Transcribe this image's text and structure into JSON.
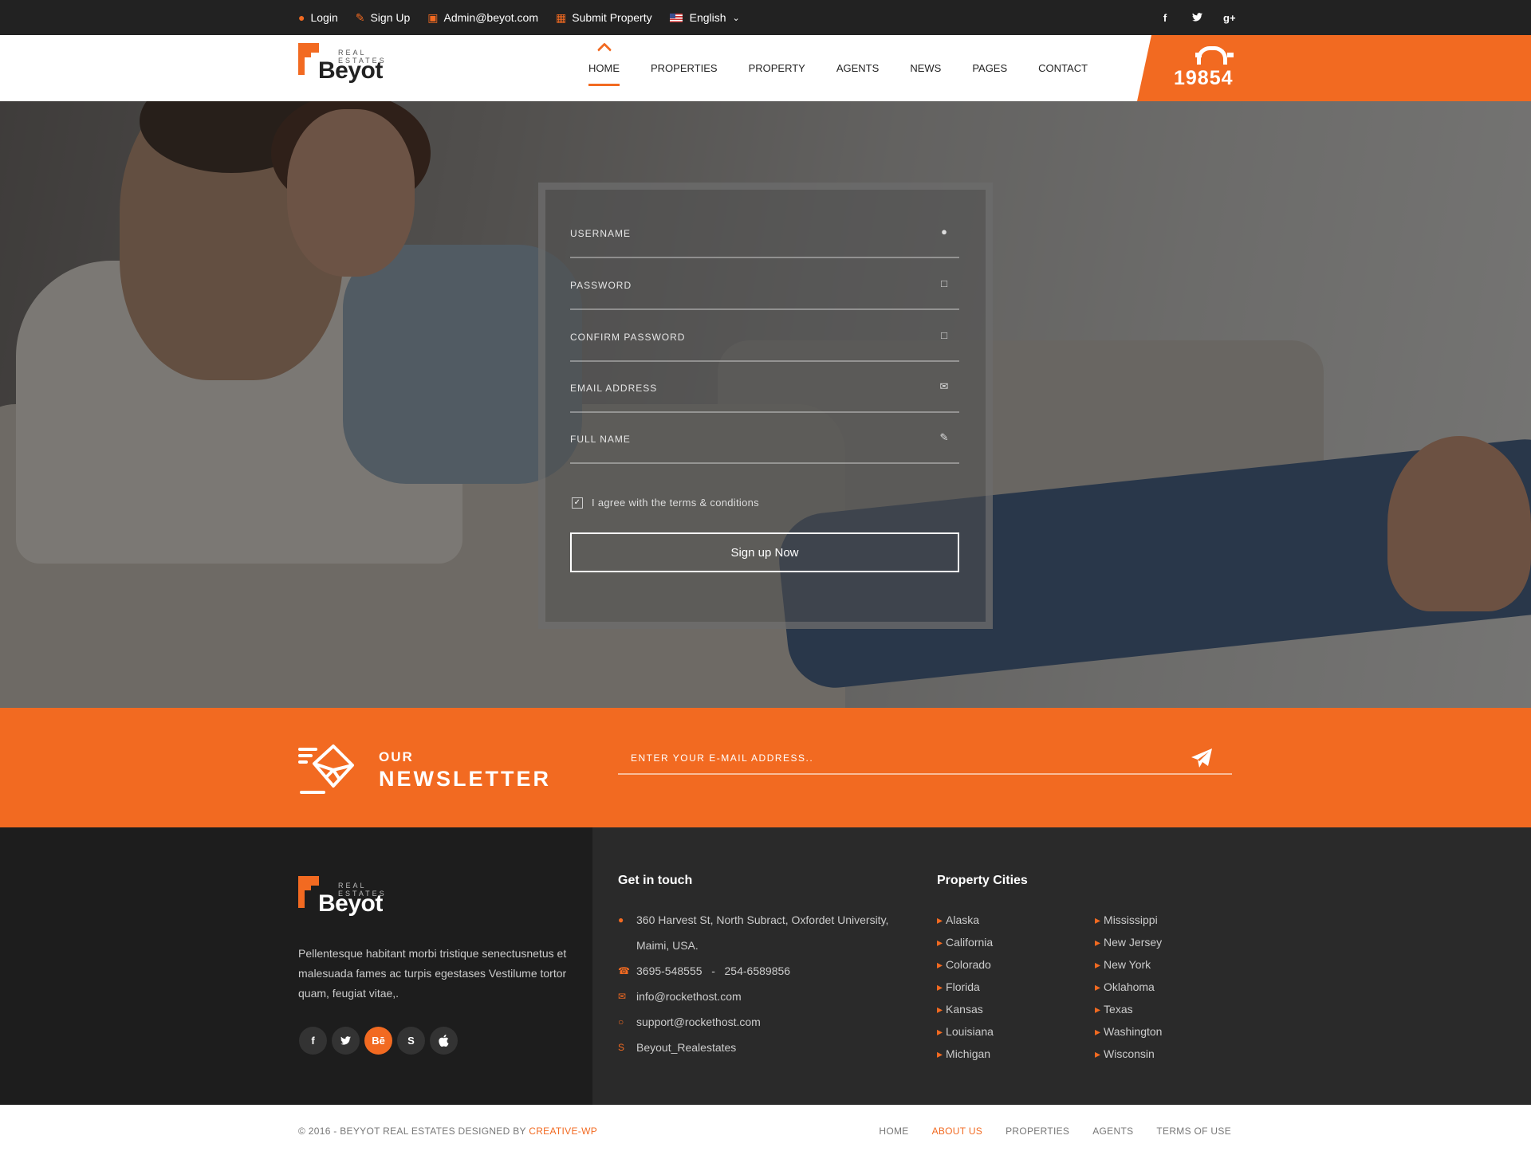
{
  "topbar": {
    "login": "Login",
    "signup": "Sign Up",
    "email": "Admin@beyot.com",
    "submit_property": "Submit Property",
    "language": "English",
    "social": [
      "f",
      "t",
      "g+"
    ]
  },
  "header": {
    "logo": {
      "tag": "REAL ESTATES",
      "name": "Beyot"
    },
    "nav": [
      "HOME",
      "PROPERTIES",
      "PROPERTY",
      "AGENTS",
      "NEWS",
      "PAGES",
      "CONTACT"
    ],
    "active_nav": "HOME",
    "phone": "19854"
  },
  "form": {
    "username_placeholder": "USERNAME",
    "password_placeholder": "PASSWORD",
    "confirm_password_placeholder": "CONFIRM PASSWORD",
    "email_placeholder": "EMAIL ADDRESS",
    "fullname_placeholder": "FULL NAME",
    "agree_label": "I agree with the terms & conditions",
    "agree_checked": true,
    "submit_label": "Sign up Now"
  },
  "newsletter": {
    "our": "OUR",
    "title": "NEWSLETTER",
    "email_placeholder": "ENTER YOUR E-MAIL ADDRESS.."
  },
  "footer": {
    "logo": {
      "tag": "REAL ESTATES",
      "name": "Beyot"
    },
    "about": "Pellentesque habitant morbi tristique senectusnetus et malesuada fames ac turpis egestases Vestilume tortor quam, feugiat vitae,.",
    "social": [
      "f",
      "t",
      "Bē",
      "S",
      "apple"
    ],
    "contact_title": "Get in touch",
    "address": "360 Harvest St, North Subract, Oxfordet University, Maimi,  USA.",
    "phone": "3695-548555   -   254-6589856",
    "email": "info@rockethost.com",
    "support": "support@rockethost.com",
    "skype": "Beyout_Realestates",
    "cities_title": "Property Cities",
    "cities_col1": [
      "Alaska",
      "California",
      "Colorado",
      "Florida",
      "Kansas",
      "Louisiana",
      "Michigan"
    ],
    "cities_col2": [
      "Mississippi",
      "New Jersey",
      "New York",
      "Oklahoma",
      "Texas",
      "Washington",
      "Wisconsin"
    ]
  },
  "bottombar": {
    "copyright": "© 2016 - BEYYOT REAL ESTATES DESIGNED BY",
    "designer": "CREATIVE-WP",
    "nav": [
      "HOME",
      "ABOUT US",
      "PROPERTIES",
      "AGENTS",
      "TERMS OF USE"
    ],
    "active_nav": "ABOUT US"
  },
  "colors": {
    "accent": "#f26a21",
    "dark": "#222222",
    "footer": "#2a2a2a"
  }
}
